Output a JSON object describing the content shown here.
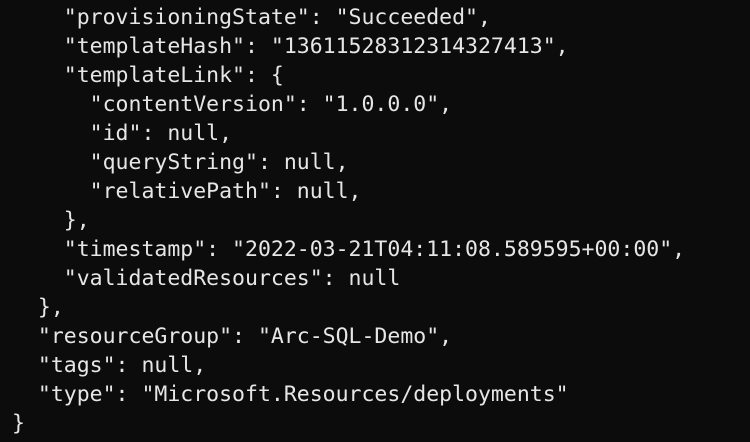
{
  "terminal": {
    "background": "#0c0c0c",
    "foreground": "#e6e6e6",
    "lines": [
      "    \"provisioningState\": \"Succeeded\",",
      "    \"templateHash\": \"13611528312314327413\",",
      "    \"templateLink\": {",
      "      \"contentVersion\": \"1.0.0.0\",",
      "      \"id\": null,",
      "      \"queryString\": null,",
      "      \"relativePath\": null,",
      "    },",
      "    \"timestamp\": \"2022-03-21T04:11:08.589595+00:00\",",
      "    \"validatedResources\": null",
      "  },",
      "  \"resourceGroup\": \"Arc-SQL-Demo\",",
      "  \"tags\": null,",
      "  \"type\": \"Microsoft.Resources/deployments\"",
      "}"
    ]
  }
}
